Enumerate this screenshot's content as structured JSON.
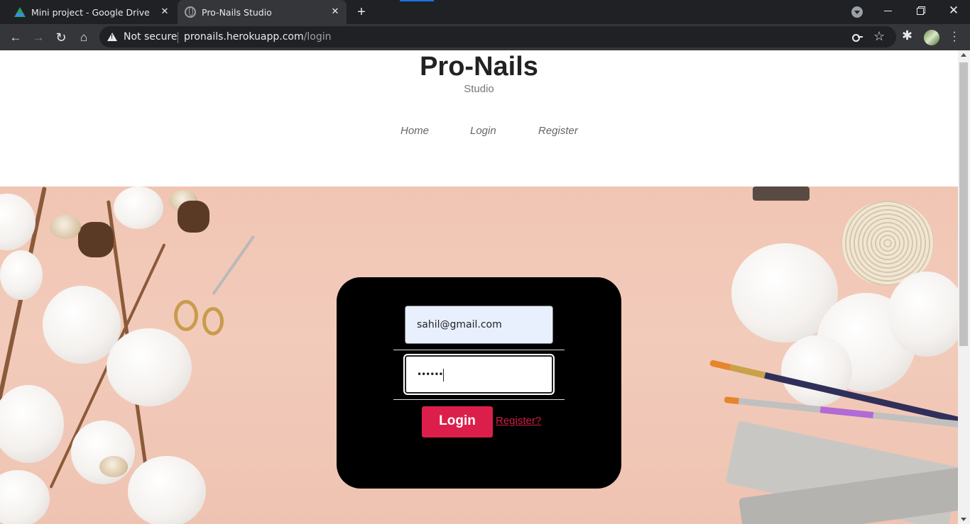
{
  "browser": {
    "tabs": [
      {
        "title": "Mini project - Google Drive",
        "icon": "google-drive-icon",
        "active": false
      },
      {
        "title": "Pro-Nails Studio",
        "icon": "globe-icon",
        "active": true
      }
    ],
    "security_label": "Not secure",
    "url_host": "pronails.herokuapp.com",
    "url_path": "/login"
  },
  "site": {
    "title": "Pro-Nails",
    "subtitle": "Studio",
    "nav": [
      "Home",
      "Login",
      "Register"
    ]
  },
  "login_form": {
    "email_value": "sahil@gmail.com",
    "password_mask": "••••••",
    "submit_label": "Login",
    "register_link": "Register?"
  },
  "colors": {
    "accent": "#dc1f4a",
    "card_bg": "#000000",
    "hero_bg": "#f1c5b3",
    "autofill_bg": "#e8f0fe"
  }
}
